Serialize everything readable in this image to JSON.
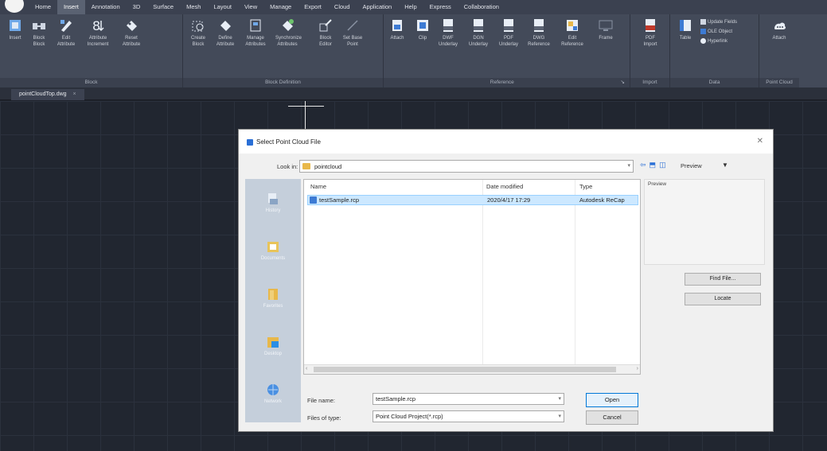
{
  "menubar": {
    "items": [
      "Home",
      "Insert",
      "Annotation",
      "3D",
      "Surface",
      "Mesh",
      "Layout",
      "View",
      "Manage",
      "Export",
      "Cloud",
      "Application",
      "Help",
      "Express",
      "Collaboration"
    ],
    "active_index": 1
  },
  "ribbon": {
    "panels": {
      "block": "Block",
      "block_definition": "Block Definition",
      "reference": "Reference",
      "import": "Import",
      "data": "Data",
      "point_cloud": "Point Cloud"
    },
    "buttons": {
      "insert": "Insert",
      "block": [
        "Block",
        "Block"
      ],
      "edit": [
        "Edit",
        "Attribute"
      ],
      "attribute": [
        "Attribute",
        "Increment"
      ],
      "reset": [
        "Reset",
        "Attribute"
      ],
      "create_block": [
        "Create",
        "Block"
      ],
      "define": [
        "Define",
        "Attribute"
      ],
      "manage": [
        "Manage",
        "Attributes"
      ],
      "synchronize": [
        "Synchronize",
        "Attributes"
      ],
      "block_editor": [
        "Block",
        "Editor"
      ],
      "set_base": [
        "Set Base",
        "Point"
      ],
      "attach": "Attach",
      "clip": "Clip",
      "dwf_underlay": [
        "DWF",
        "Underlay"
      ],
      "dgn_underlay": [
        "DGN",
        "Underlay"
      ],
      "pdf_underlay": [
        "PDF",
        "Underlay"
      ],
      "dwg_reference": [
        "DWG",
        "Reference"
      ],
      "edit_reference": [
        "Edit",
        "Reference"
      ],
      "frame": "Frame",
      "pdf_import": [
        "PDF",
        "Import"
      ],
      "table": "Table",
      "update_fields": "Update Fields",
      "ole_object": "OLE Object",
      "hyperlink": "Hyperlink",
      "pc_attach": "Attach"
    }
  },
  "tab": {
    "file_name": "pointCloudTop.dwg",
    "close": "×"
  },
  "dialog": {
    "title": "Select Point Cloud File",
    "close": "✕",
    "look_in_label": "Look in:",
    "look_in_value": "pointcloud",
    "preview_label": "Preview",
    "preview_area_title": "Preview",
    "columns": {
      "name": "Name",
      "date": "Date modified",
      "type": "Type"
    },
    "files": [
      {
        "name": "testSample.rcp",
        "date": "2020/4/17 17:29",
        "type": "Autodesk ReCap"
      }
    ],
    "places": [
      "History",
      "Documents",
      "Favorites",
      "Desktop",
      "Network"
    ],
    "file_name_label": "File name:",
    "file_name_value": "testSample.rcp",
    "files_of_type_label": "Files of type:",
    "files_of_type_value": "Point Cloud Project(*.rcp)",
    "find_file_button": "Find File...",
    "locate_button": "Locate",
    "open_button": "Open",
    "cancel_button": "Cancel"
  }
}
